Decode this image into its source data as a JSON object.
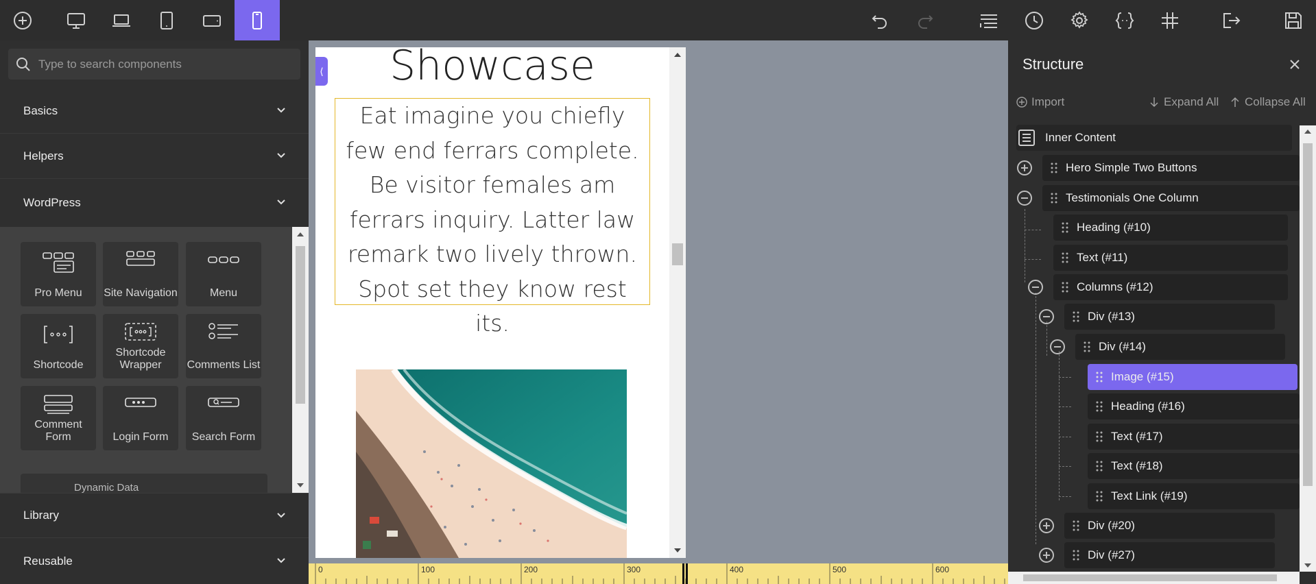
{
  "toolbar": {
    "left_icons": [
      "add-icon",
      "desktop-icon",
      "laptop-icon",
      "tablet-portrait-icon",
      "tablet-landscape-icon",
      "mobile-icon"
    ],
    "right_icons": [
      "undo-icon",
      "redo-icon",
      "structure-icon",
      "history-icon",
      "settings-icon",
      "code-icon",
      "grid-icon",
      "exit-icon",
      "save-icon"
    ],
    "accent": "#7b68ee"
  },
  "sidebar": {
    "search_placeholder": "Type to search components",
    "categories": [
      "Basics",
      "Helpers",
      "WordPress"
    ],
    "components": [
      {
        "label": "Pro Menu",
        "icon": "pro-menu-icon"
      },
      {
        "label": "Site Navigation",
        "icon": "site-navigation-icon"
      },
      {
        "label": "Menu",
        "icon": "menu-icon"
      },
      {
        "label": "Shortcode",
        "icon": "shortcode-icon"
      },
      {
        "label": "Shortcode Wrapper",
        "icon": "shortcode-wrapper-icon"
      },
      {
        "label": "Comments List",
        "icon": "comments-list-icon"
      },
      {
        "label": "Comment Form",
        "icon": "comment-form-icon"
      },
      {
        "label": "Login Form",
        "icon": "login-form-icon"
      },
      {
        "label": "Search Form",
        "icon": "search-form-icon"
      }
    ],
    "dynamic_data": "Dynamic Data",
    "bottom_categories": [
      "Library",
      "Reusable"
    ]
  },
  "canvas": {
    "heading": "Showcase",
    "paragraph": "Eat imagine you chiefly few end ferrars complete. Be visitor females am ferrars inquiry. Latter law remark two lively thrown. Spot set they know rest its.",
    "ruler_labels": [
      "0",
      "100",
      "200",
      "300",
      "400",
      "500",
      "600"
    ]
  },
  "structure": {
    "title": "Structure",
    "import": "Import",
    "expand_all": "Expand All",
    "collapse_all": "Collapse All",
    "nodes": [
      "Inner Content",
      "Hero Simple Two Buttons",
      "Testimonials One Column",
      "Heading (#10)",
      "Text (#11)",
      "Columns (#12)",
      "Div (#13)",
      "Div (#14)",
      "Image (#15)",
      "Heading (#16)",
      "Text (#17)",
      "Text (#18)",
      "Text Link (#19)",
      "Div (#20)",
      "Div (#27)"
    ]
  }
}
